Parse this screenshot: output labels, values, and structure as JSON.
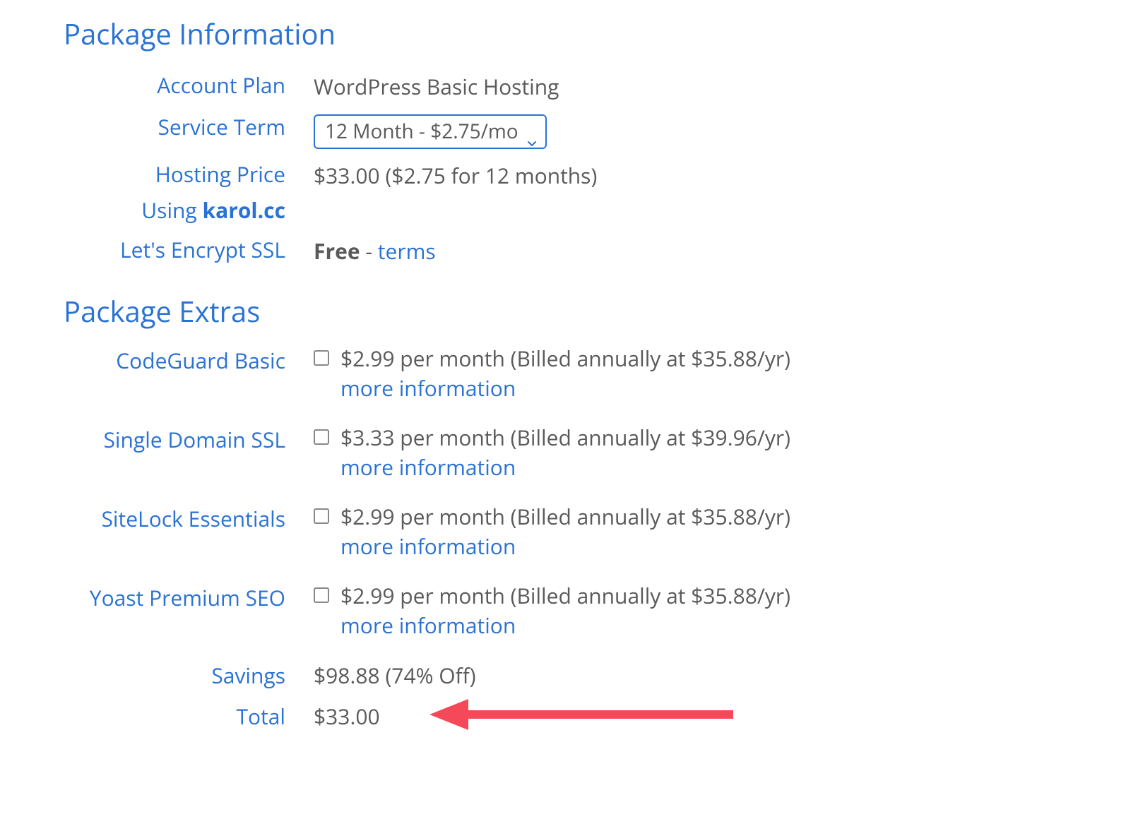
{
  "sections": {
    "package_info_title": "Package Information",
    "package_extras_title": "Package Extras"
  },
  "info": {
    "account_plan_label": "Account Plan",
    "account_plan_value": "WordPress Basic Hosting",
    "service_term_label": "Service Term",
    "service_term_value": "12 Month - $2.75/mo",
    "hosting_price_label": "Hosting Price",
    "hosting_price_value": "$33.00 ($2.75 for 12 months)",
    "using_label_prefix": "Using ",
    "using_domain": "karol.cc",
    "ssl_label": "Let's Encrypt SSL",
    "ssl_free": "Free",
    "ssl_sep": " - ",
    "ssl_terms": "terms"
  },
  "extras": [
    {
      "label": "CodeGuard Basic",
      "price": "$2.99 per month (Billed annually at $35.88/yr)",
      "more": "more information"
    },
    {
      "label": "Single Domain SSL",
      "price": "$3.33 per month (Billed annually at $39.96/yr)",
      "more": "more information"
    },
    {
      "label": "SiteLock Essentials",
      "price": "$2.99 per month (Billed annually at $35.88/yr)",
      "more": "more information"
    },
    {
      "label": "Yoast Premium SEO",
      "price": "$2.99 per month (Billed annually at $35.88/yr)",
      "more": "more information"
    }
  ],
  "summary": {
    "savings_label": "Savings",
    "savings_value": "$98.88 (74% Off)",
    "total_label": "Total",
    "total_value": "$33.00"
  }
}
